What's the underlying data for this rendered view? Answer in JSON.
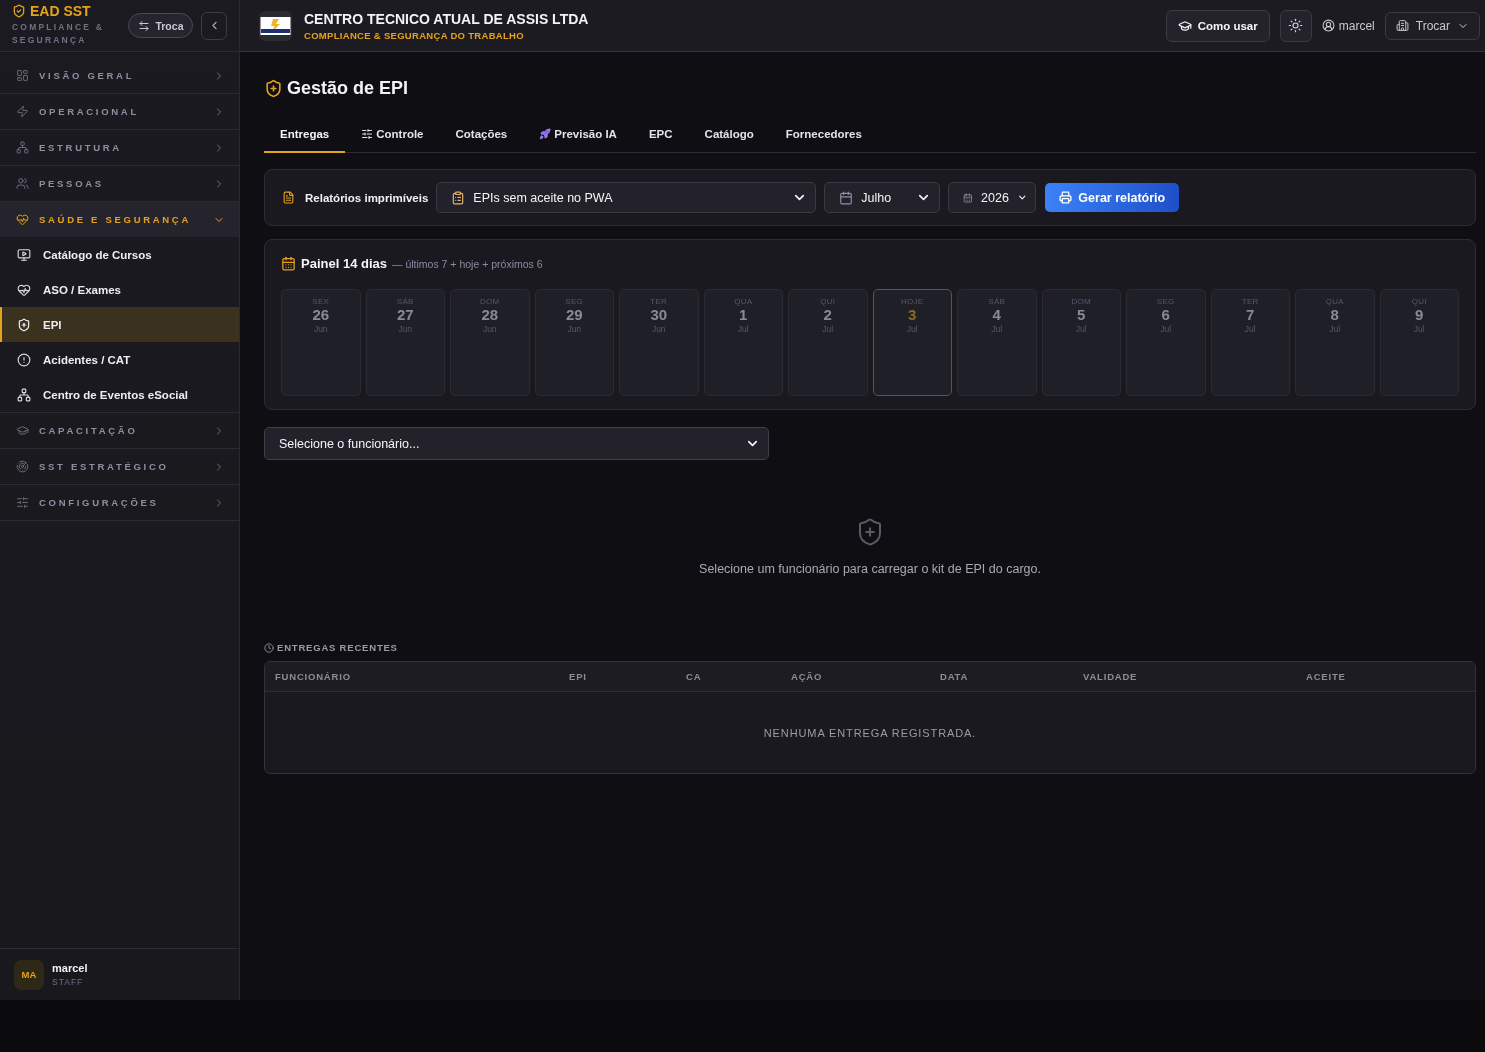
{
  "sidebar": {
    "brand": {
      "name": "EAD SST",
      "tagline": "COMPLIANCE & SEGURANÇA"
    },
    "switch_button": "Troca",
    "sections": [
      {
        "label": "VISÃO GERAL",
        "expanded": false
      },
      {
        "label": "OPERACIONAL",
        "expanded": false
      },
      {
        "label": "ESTRUTURA",
        "expanded": false
      },
      {
        "label": "PESSOAS",
        "expanded": false
      },
      {
        "label": "SAÚDE E SEGURANÇA",
        "expanded": true,
        "children": [
          {
            "label": "Catálogo de Cursos",
            "selected": false
          },
          {
            "label": "ASO / Exames",
            "selected": false
          },
          {
            "label": "EPI",
            "selected": true
          },
          {
            "label": "Acidentes / CAT",
            "selected": false
          },
          {
            "label": "Centro de Eventos eSocial",
            "selected": false
          }
        ]
      },
      {
        "label": "CAPACITAÇÃO",
        "expanded": false
      },
      {
        "label": "SST ESTRATÉGICO",
        "expanded": false
      },
      {
        "label": "CONFIGURAÇÕES",
        "expanded": false
      }
    ],
    "user": {
      "initials": "MA",
      "name": "marcel",
      "role": "STAFF"
    }
  },
  "header": {
    "company": {
      "name": "CENTRO TECNICO ATUAL DE ASSIS LTDA",
      "subtitle": "COMPLIANCE & SEGURANÇA DO TRABALHO"
    },
    "help_button": "Como usar",
    "user": "marcel",
    "switch_button": "Trocar"
  },
  "page": {
    "title": "Gestão de EPI",
    "tabs": [
      {
        "label": "Entregas",
        "selected": true
      },
      {
        "label": "Controle",
        "selected": false
      },
      {
        "label": "Cotações",
        "selected": false
      },
      {
        "label": "Previsão IA",
        "selected": false
      },
      {
        "label": "EPC",
        "selected": false
      },
      {
        "label": "Catálogo",
        "selected": false
      },
      {
        "label": "Fornecedores",
        "selected": false
      }
    ]
  },
  "reports": {
    "label": "Relatórios imprimíveis",
    "report_select": "EPIs sem aceite no PWA",
    "month_select": "Julho",
    "year_select": "2026",
    "generate_button": "Gerar relatório"
  },
  "panel": {
    "title": "Painel 14 dias",
    "subtitle": "— últimos 7 + hoje + próximos 6",
    "days": [
      {
        "weekday": "SEX",
        "day": "26",
        "month": "Jun",
        "today": false
      },
      {
        "weekday": "SÁB",
        "day": "27",
        "month": "Jun",
        "today": false
      },
      {
        "weekday": "DOM",
        "day": "28",
        "month": "Jun",
        "today": false
      },
      {
        "weekday": "SEG",
        "day": "29",
        "month": "Jun",
        "today": false
      },
      {
        "weekday": "TER",
        "day": "30",
        "month": "Jun",
        "today": false
      },
      {
        "weekday": "QUA",
        "day": "1",
        "month": "Jul",
        "today": false
      },
      {
        "weekday": "QUI",
        "day": "2",
        "month": "Jul",
        "today": false
      },
      {
        "weekday": "HOJE",
        "day": "3",
        "month": "Jul",
        "today": true
      },
      {
        "weekday": "SÁB",
        "day": "4",
        "month": "Jul",
        "today": false
      },
      {
        "weekday": "DOM",
        "day": "5",
        "month": "Jul",
        "today": false
      },
      {
        "weekday": "SEG",
        "day": "6",
        "month": "Jul",
        "today": false
      },
      {
        "weekday": "TER",
        "day": "7",
        "month": "Jul",
        "today": false
      },
      {
        "weekday": "QUA",
        "day": "8",
        "month": "Jul",
        "today": false
      },
      {
        "weekday": "QUI",
        "day": "9",
        "month": "Jul",
        "today": false
      }
    ]
  },
  "employee_select": {
    "placeholder": "Selecione o funcionário..."
  },
  "empty_state": {
    "message": "Selecione um funcionário para carregar o kit de EPI do cargo."
  },
  "recent": {
    "title": "ENTREGAS RECENTES",
    "columns": [
      "FUNCIONÁRIO",
      "EPI",
      "CA",
      "AÇÃO",
      "DATA",
      "VALIDADE",
      "ACEITE"
    ],
    "empty_message": "NENHUMA ENTREGA REGISTRADA."
  }
}
